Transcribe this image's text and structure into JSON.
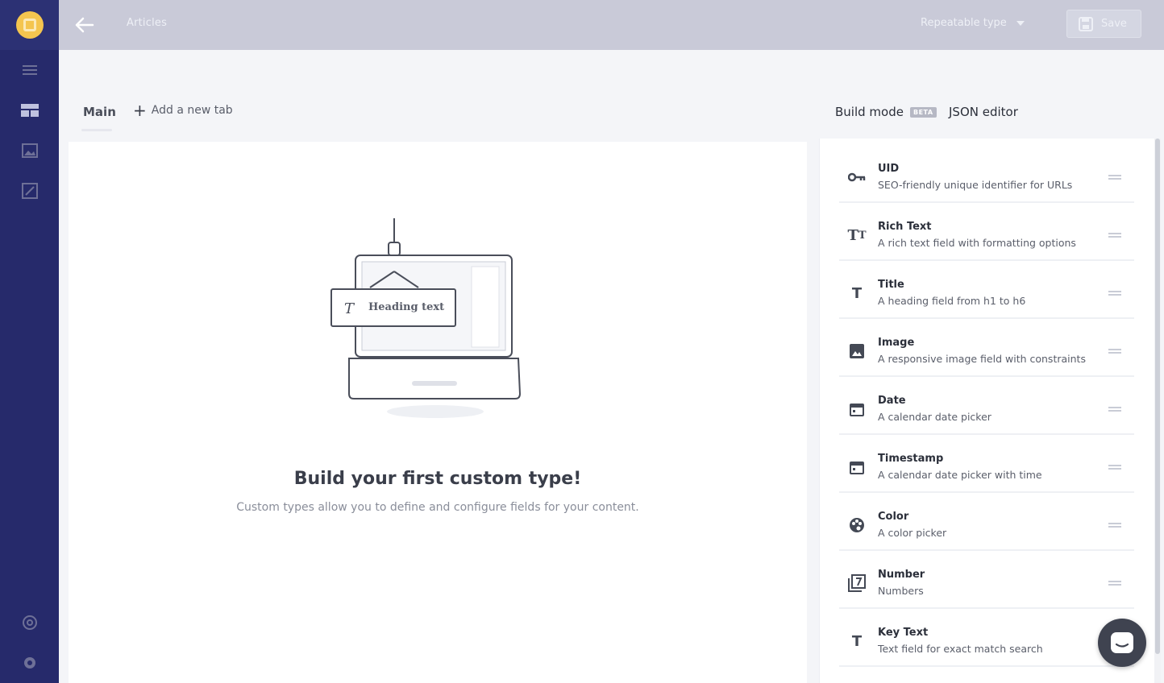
{
  "header": {
    "title": "Articles",
    "type_select": "Repeatable type",
    "save_label": "Save"
  },
  "tabs": {
    "main": "Main",
    "add_tab": "Add a new tab",
    "build_mode": "Build mode",
    "beta": "BETA",
    "json_editor": "JSON editor"
  },
  "empty_state": {
    "illustration_label": "Heading text",
    "title": "Build your first custom type!",
    "subtitle": "Custom types allow you to define and configure fields for your content."
  },
  "fields": [
    {
      "name": "UID",
      "desc": "SEO-friendly unique identifier for URLs",
      "icon": "key-icon"
    },
    {
      "name": "Rich Text",
      "desc": "A rich text field with formatting options",
      "icon": "rich-text-icon"
    },
    {
      "name": "Title",
      "desc": "A heading field from h1 to h6",
      "icon": "title-icon"
    },
    {
      "name": "Image",
      "desc": "A responsive image field with constraints",
      "icon": "image-icon"
    },
    {
      "name": "Date",
      "desc": "A calendar date picker",
      "icon": "calendar-icon"
    },
    {
      "name": "Timestamp",
      "desc": "A calendar date picker with time",
      "icon": "calendar-icon"
    },
    {
      "name": "Color",
      "desc": "A color picker",
      "icon": "palette-icon"
    },
    {
      "name": "Number",
      "desc": "Numbers",
      "icon": "number-icon"
    },
    {
      "name": "Key Text",
      "desc": "Text field for exact match search",
      "icon": "text-icon"
    }
  ],
  "colors": {
    "sidebar": "#262a6b",
    "logo": "#f4c54f",
    "header": "#c9cad8"
  }
}
